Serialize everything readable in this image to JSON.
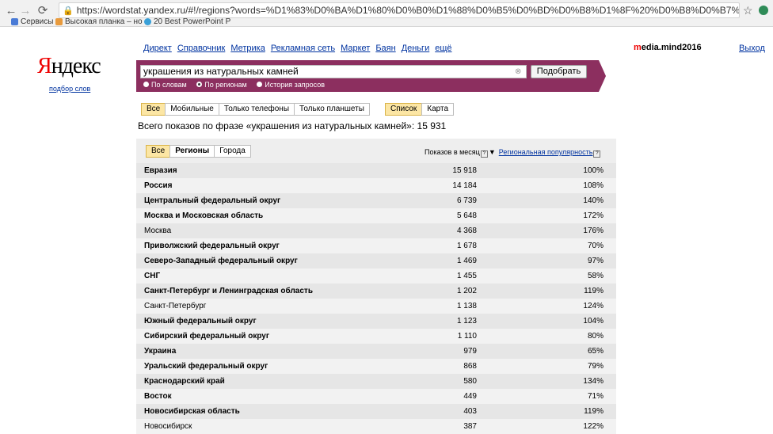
{
  "browser": {
    "url": "https://wordstat.yandex.ru/#!/regions?words=%D1%83%D0%BA%D1%80%D0%B0%D1%88%D0%B5%D0%BD%D0%B8%D1%8F%20%D0%B8%D0%B7%20%D0%BD%D0%B0%D1%82",
    "bookmarks": [
      "Сервисы",
      "Высокая планка – но",
      "20 Best PowerPoint P"
    ]
  },
  "topnav": [
    "Директ",
    "Справочник",
    "Метрика",
    "Рекламная сеть",
    "Маркет",
    "Баян",
    "Деньги",
    "ещё"
  ],
  "user": {
    "first": "m",
    "rest": "edia.mind2016",
    "exit": "Выход"
  },
  "logo": {
    "first": "Я",
    "rest": "ндекс",
    "sub": "подбор слов"
  },
  "search": {
    "query": "украшения из натуральных камней",
    "button": "Подобрать",
    "modes": [
      "По словам",
      "По регионам",
      "История запросов"
    ]
  },
  "device_tabs": [
    "Все",
    "Мобильные",
    "Только телефоны",
    "Только планшеты"
  ],
  "view_tabs": [
    "Список",
    "Карта"
  ],
  "summary": "Всего показов по фразе «украшения из натуральных камней»: 15 931",
  "table": {
    "tabs": [
      "Все",
      "Регионы",
      "Города"
    ],
    "col_shows": "Показов в месяц",
    "col_pop": "Региональная популярность",
    "rows": [
      {
        "region": "Евразия",
        "bold": true,
        "count": "15 918",
        "pct": "100%"
      },
      {
        "region": "Россия",
        "bold": true,
        "count": "14 184",
        "pct": "108%"
      },
      {
        "region": "Центральный федеральный округ",
        "bold": true,
        "count": "6 739",
        "pct": "140%"
      },
      {
        "region": "Москва и Московская область",
        "bold": true,
        "count": "5 648",
        "pct": "172%"
      },
      {
        "region": "Москва",
        "bold": false,
        "count": "4 368",
        "pct": "176%"
      },
      {
        "region": "Приволжский федеральный округ",
        "bold": true,
        "count": "1 678",
        "pct": "70%"
      },
      {
        "region": "Северо-Западный федеральный округ",
        "bold": true,
        "count": "1 469",
        "pct": "97%"
      },
      {
        "region": "СНГ",
        "bold": true,
        "count": "1 455",
        "pct": "58%"
      },
      {
        "region": "Санкт-Петербург и Ленинградская область",
        "bold": true,
        "count": "1 202",
        "pct": "119%"
      },
      {
        "region": "Санкт-Петербург",
        "bold": false,
        "count": "1 138",
        "pct": "124%"
      },
      {
        "region": "Южный федеральный округ",
        "bold": true,
        "count": "1 123",
        "pct": "104%"
      },
      {
        "region": "Сибирский федеральный округ",
        "bold": true,
        "count": "1 110",
        "pct": "80%"
      },
      {
        "region": "Украина",
        "bold": true,
        "count": "979",
        "pct": "65%"
      },
      {
        "region": "Уральский федеральный округ",
        "bold": true,
        "count": "868",
        "pct": "79%"
      },
      {
        "region": "Краснодарский край",
        "bold": true,
        "count": "580",
        "pct": "134%"
      },
      {
        "region": "Восток",
        "bold": true,
        "count": "449",
        "pct": "71%"
      },
      {
        "region": "Новосибирская область",
        "bold": true,
        "count": "403",
        "pct": "119%"
      },
      {
        "region": "Новосибирск",
        "bold": false,
        "count": "387",
        "pct": "122%"
      }
    ]
  }
}
